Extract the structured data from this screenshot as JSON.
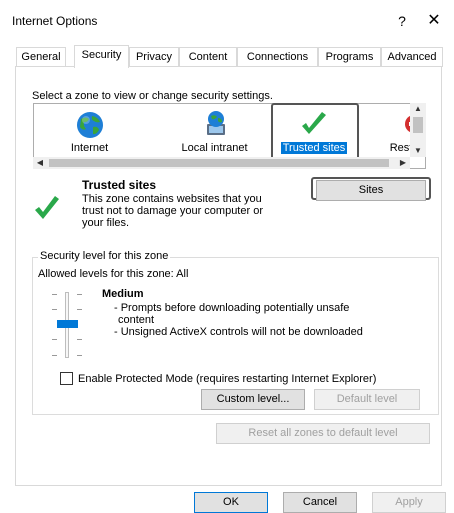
{
  "window": {
    "title": "Internet Options",
    "help": "?",
    "close": "✕"
  },
  "tabs": [
    {
      "label": "General"
    },
    {
      "label": "Security"
    },
    {
      "label": "Privacy"
    },
    {
      "label": "Content"
    },
    {
      "label": "Connections"
    },
    {
      "label": "Programs"
    },
    {
      "label": "Advanced"
    }
  ],
  "active_tab": "Security",
  "zones": {
    "prompt": "Select a zone to view or change security settings.",
    "items": [
      {
        "label": "Internet",
        "icon": "globe-icon"
      },
      {
        "label": "Local intranet",
        "icon": "intranet-icon"
      },
      {
        "label": "Trusted sites",
        "icon": "checkmark-icon"
      },
      {
        "label": "Restr",
        "icon": "restricted-icon"
      }
    ],
    "selected": "Trusted sites"
  },
  "zone_info": {
    "title": "Trusted sites",
    "description_lines": [
      "This zone contains websites that you",
      "trust not to damage your computer or",
      "your files."
    ],
    "sites_button": "Sites"
  },
  "security_level": {
    "group_title": "Security level for this zone",
    "allowed": "Allowed levels for this zone: All",
    "level": "Medium",
    "lines": [
      "- Prompts before downloading potentially unsafe",
      "content",
      "- Unsigned ActiveX controls will not be downloaded"
    ],
    "protected_mode_label": "Enable Protected Mode (requires restarting Internet Explorer)",
    "protected_mode_checked": false,
    "custom_level_button": "Custom level...",
    "default_level_button": "Default level",
    "reset_all_button": "Reset all zones to default level"
  },
  "footer": {
    "ok": "OK",
    "cancel": "Cancel",
    "apply": "Apply"
  },
  "colors": {
    "accent": "#0078d7",
    "check_green": "#2aa84a"
  }
}
